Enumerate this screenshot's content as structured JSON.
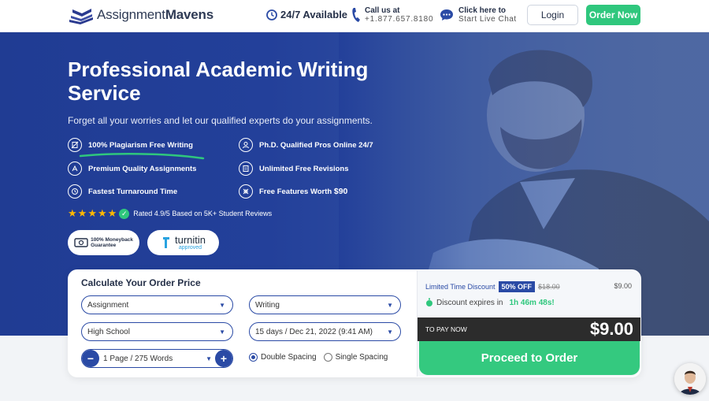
{
  "header": {
    "logo": {
      "part1": "Assignment",
      "part2": "Mavens",
      "icon": "books-icon"
    },
    "availability": "24/7 Available",
    "call": {
      "label": "Call us at",
      "phone": "+1.877.657.8180"
    },
    "chat": {
      "label": "Click here to",
      "sub": "Start Live Chat"
    },
    "login_label": "Login",
    "order_label": "Order Now"
  },
  "hero": {
    "title": "Professional Academic Writing Service",
    "subtitle": "Forget all your worries and let our qualified experts do your assignments.",
    "features": [
      {
        "label": "100% Plagiarism Free Writing",
        "icon": "no-copy-icon"
      },
      {
        "label": "Ph.D. Qualified Pros Online 24/7",
        "icon": "graduate-icon"
      },
      {
        "label": "Premium Quality Assignments",
        "icon": "quality-icon"
      },
      {
        "label": "Unlimited Free Revisions",
        "icon": "revision-icon"
      },
      {
        "label": "Fastest Turnaround Time",
        "icon": "clock-icon"
      },
      {
        "label": "Free Features Worth ",
        "label_bold": "$90",
        "icon": "gift-icon"
      }
    ],
    "rating": {
      "stars": 5,
      "text": "Rated 4.9/5 Based on 5K+ Student Reviews"
    },
    "badges": {
      "moneyback_line1": "100% Moneyback",
      "moneyback_line2": "Guarantee",
      "turnitin_line1": "turnitin",
      "turnitin_line2": "approved"
    }
  },
  "calculator": {
    "title": "Calculate Your Order Price",
    "paper_type": "Assignment",
    "service": "Writing",
    "level": "High School",
    "deadline": "15 days / Dec 21, 2022 (9:41 AM)",
    "pages": "1 Page / 275 Words",
    "spacing_options": [
      "Double Spacing",
      "Single Spacing"
    ],
    "spacing_selected": "Double Spacing",
    "discount_label": "Limited Time Discount",
    "discount_pct": "50% OFF",
    "original_price": "$18.00",
    "unit_price": "$9.00",
    "expires_label": "Discount expires in",
    "expires_time": "1h 46m 48s!",
    "to_pay_label": "TO PAY NOW",
    "to_pay_amount": "$9.00",
    "proceed_label": "Proceed to Order"
  },
  "colors": {
    "brand_blue": "#23409a",
    "accent_green": "#2fc77d",
    "dark_bar": "#2c2c2c"
  }
}
